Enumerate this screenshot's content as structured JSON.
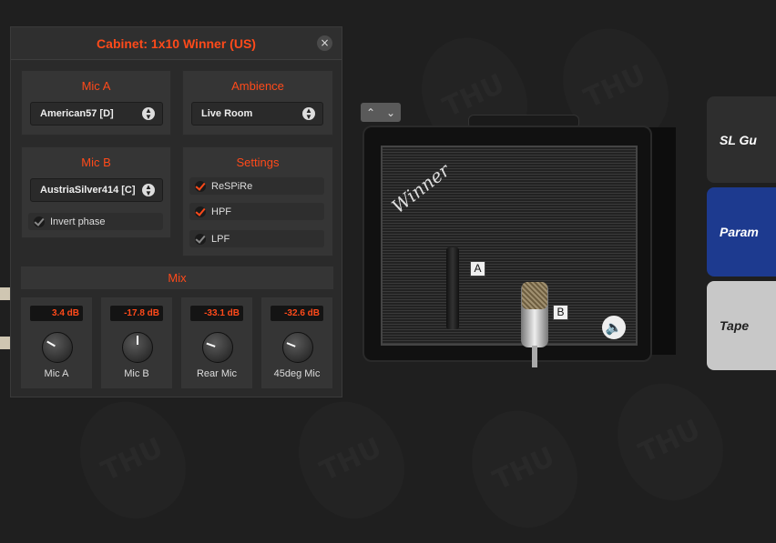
{
  "panel": {
    "title": "Cabinet: 1x10 Winner (US)",
    "close_glyph": "×"
  },
  "mic_a": {
    "title": "Mic A",
    "selected": "American57 [D]"
  },
  "ambience": {
    "title": "Ambience",
    "selected": "Live Room"
  },
  "mic_b": {
    "title": "Mic B",
    "selected": "AustriaSilver414 [C]",
    "invert_phase": {
      "label": "Invert phase",
      "checked": false
    }
  },
  "settings": {
    "title": "Settings",
    "respire": {
      "label": "ReSPiRe",
      "checked": true
    },
    "hpf": {
      "label": "HPF",
      "checked": true
    },
    "lpf": {
      "label": "LPF",
      "checked": false
    }
  },
  "mix": {
    "title": "Mix",
    "channels": [
      {
        "label": "Mic A",
        "db": "3.4 dB"
      },
      {
        "label": "Mic B",
        "db": "-17.8 dB"
      },
      {
        "label": "Rear Mic",
        "db": "-33.1 dB"
      },
      {
        "label": "45deg Mic",
        "db": "-32.6 dB"
      }
    ]
  },
  "amp": {
    "brand": "Winner",
    "mic_a_tag": "A",
    "mic_b_tag": "B",
    "arrows": [
      "⌃",
      "⌄"
    ]
  },
  "side_modules": [
    "SL Gu",
    "Param",
    "Tape"
  ],
  "background_watermark": "THU",
  "colors": {
    "accent": "#ff4a1a",
    "panel_bg": "#2a2a2a",
    "box_bg": "#353535",
    "param_module": "#1d3a8f"
  },
  "icons": {
    "speaker": "speaker-icon",
    "close": "close-icon",
    "select_arrows": "updown-arrows-icon"
  }
}
